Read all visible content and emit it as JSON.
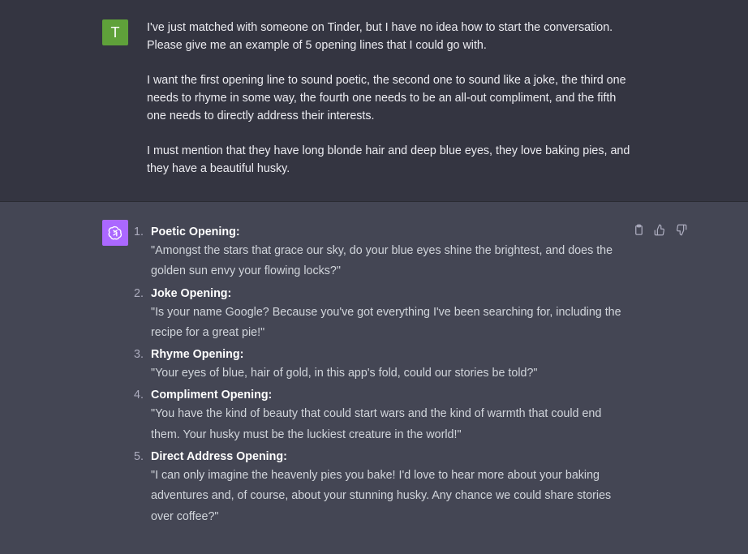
{
  "user_message": {
    "avatar_letter": "T",
    "paragraphs": [
      "I've just matched with someone on Tinder, but I have no idea how to start the conversation. Please give me an example of 5 opening lines that I could go with.",
      "I want the first opening line to sound poetic, the second one to sound like a joke, the third one needs to rhyme in some way, the fourth one needs to be an all-out compliment, and the fifth one needs to directly address their interests.",
      "I must mention that they have long blonde hair and deep blue eyes, they love baking pies, and they have a beautiful husky."
    ]
  },
  "assistant_message": {
    "avatar_icon": "openai-logo-icon",
    "items": [
      {
        "number": "1.",
        "title": "Poetic Opening:",
        "text": "\"Amongst the stars that grace our sky, do your blue eyes shine the brightest, and does the golden sun envy your flowing locks?\""
      },
      {
        "number": "2.",
        "title": "Joke Opening:",
        "text": "\"Is your name Google? Because you've got everything I've been searching for, including the recipe for a great pie!\""
      },
      {
        "number": "3.",
        "title": "Rhyme Opening:",
        "text": "\"Your eyes of blue, hair of gold, in this app's fold, could our stories be told?\""
      },
      {
        "number": "4.",
        "title": "Compliment Opening:",
        "text": "\"You have the kind of beauty that could start wars and the kind of warmth that could end them. Your husky must be the luckiest creature in the world!\""
      },
      {
        "number": "5.",
        "title": "Direct Address Opening:",
        "text": "\"I can only imagine the heavenly pies you bake! I'd love to hear more about your baking adventures and, of course, about your stunning husky. Any chance we could share stories over coffee?\""
      }
    ],
    "actions": [
      "clipboard-icon",
      "thumbs-up-icon",
      "thumbs-down-icon"
    ]
  },
  "colors": {
    "user_bg": "#343541",
    "assistant_bg": "#444654",
    "user_avatar": "#5fa13a",
    "assistant_avatar": "#ab68ff"
  }
}
